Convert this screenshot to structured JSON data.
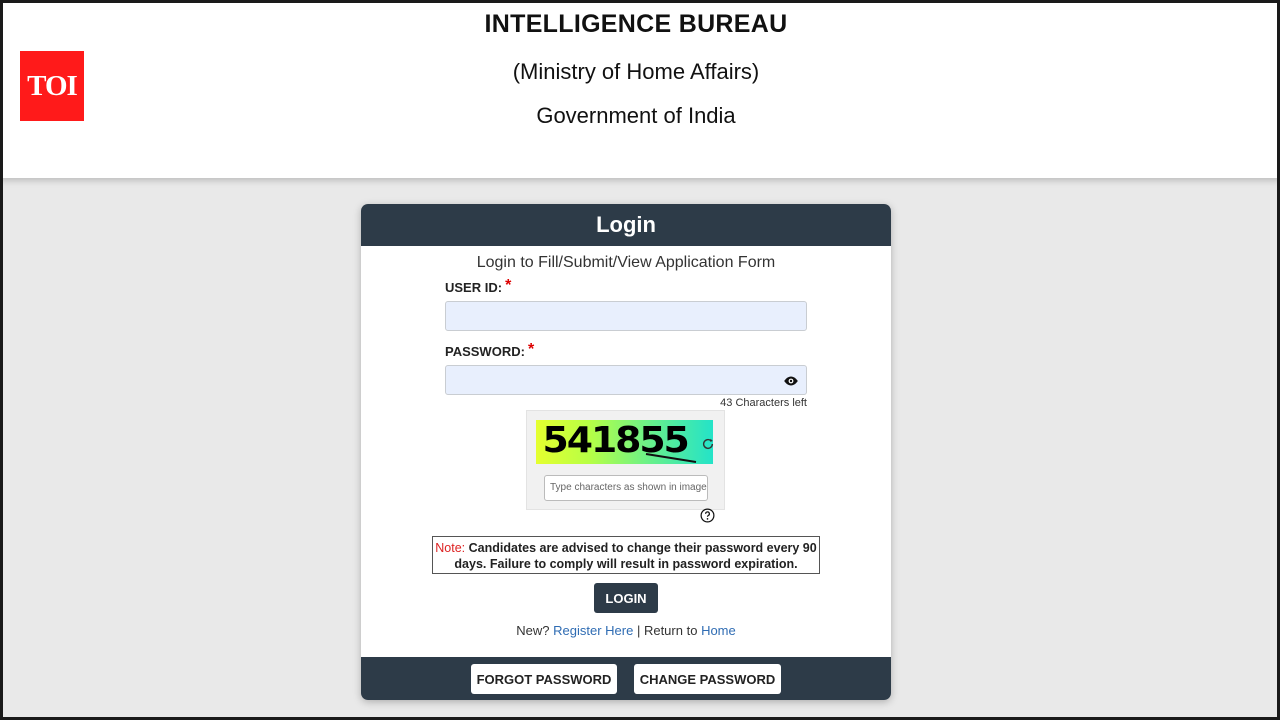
{
  "logo": {
    "text": "TOI"
  },
  "header": {
    "title": "INTELLIGENCE BUREAU",
    "ministry": "(Ministry of Home Affairs)",
    "government": "Government of India"
  },
  "login": {
    "heading": "Login",
    "subtitle": "Login to Fill/Submit/View Application Form",
    "user_id_label": "USER ID:",
    "password_label": "PASSWORD:",
    "required_mark": "*",
    "chars_left": "43 Characters left",
    "captcha_code": "541855",
    "captcha_placeholder": "Type characters as shown in image",
    "note_label": "Note:",
    "note_text": "Candidates are advised to change their password every 90 days. Failure to comply will result in password expiration.",
    "login_button": "LOGIN",
    "new_text": "New?",
    "register_link": "Register Here",
    "separator": "|",
    "return_text": "Return to",
    "home_link": "Home"
  },
  "footer": {
    "forgot_password": "FORGOT PASSWORD",
    "change_password": "CHANGE PASSWORD"
  },
  "icons": {
    "eye": "eye-icon",
    "refresh": "refresh-icon",
    "help": "help-icon"
  },
  "colors": {
    "card_header": "#2d3b48",
    "logo_red": "#ff1a1a",
    "link": "#2f6cb3",
    "required": "#dd0000"
  }
}
